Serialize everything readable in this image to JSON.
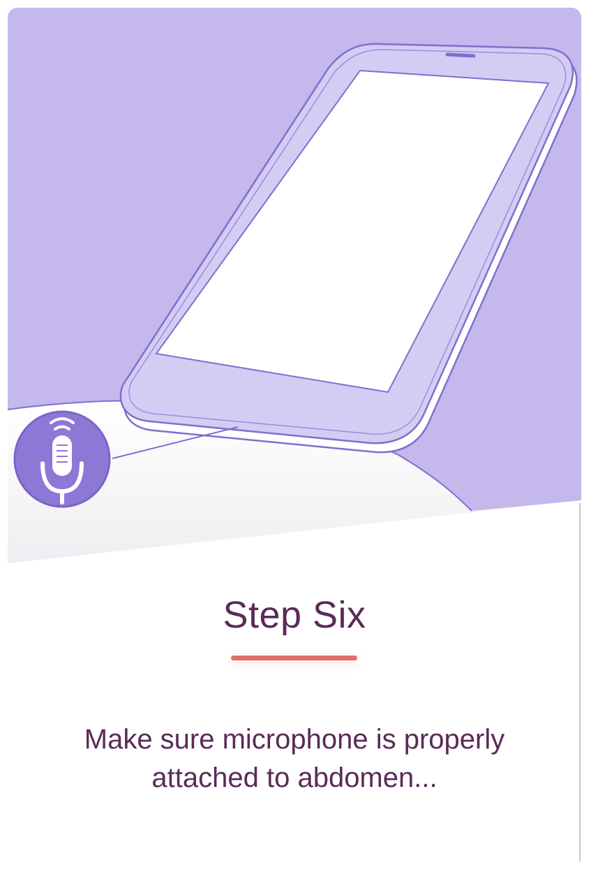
{
  "step": {
    "title": "Step Six",
    "instruction": "Make sure microphone is properly attached to abdomen..."
  },
  "colors": {
    "background_purple": "#c4b8ec",
    "phone_body": "#d4ccf3",
    "phone_outline": "#7f6fcf",
    "mic_badge": "#8d78d6",
    "title_text": "#5a2b57",
    "accent_underline": "#e26e6a"
  },
  "icons": {
    "microphone": "microphone-icon",
    "phone": "smartphone-illustration"
  }
}
